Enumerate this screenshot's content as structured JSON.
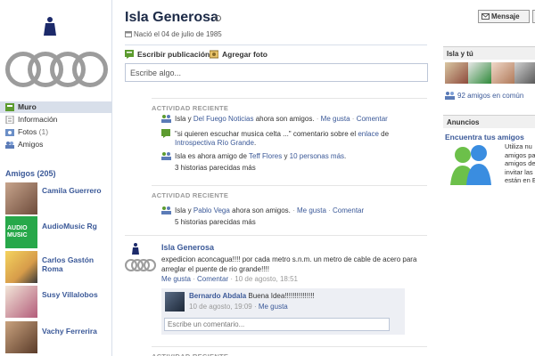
{
  "profile": {
    "name": "Isla Generosa",
    "birth": "Nació el 04 de julio de 1985"
  },
  "left_nav": {
    "items": [
      {
        "label": "Muro",
        "active": true
      },
      {
        "label": "Información"
      },
      {
        "label": "Fotos",
        "count": "(1)"
      },
      {
        "label": "Amigos"
      }
    ],
    "friends_header": "Amigos (205)",
    "friends": [
      {
        "name": "Camila Guerrero"
      },
      {
        "name": "AudioMusic Rg",
        "pic_text": "AUDIO\nMUSIC"
      },
      {
        "name": "Carlos Gastón Roma"
      },
      {
        "name": "Susy Villalobos"
      },
      {
        "name": "Vachy Ferrerira"
      }
    ]
  },
  "tabs": {
    "write_post": "Escribir publicación",
    "add_photo": "Agregar foto"
  },
  "composer": {
    "placeholder": "Escribe algo..."
  },
  "activity": [
    {
      "header": "ACTIVIDAD RECIENTE",
      "line1": {
        "pre": "Isla y ",
        "link": "Del Fuego Noticias",
        "post": " ahora son amigos.",
        "action1": "Me gusta",
        "action2": "Comentar"
      },
      "line2a": {
        "text1": "\"si quieren escuchar musica celta ...\"",
        "text2": " comentario sobre el ",
        "link": "enlace",
        "text3": " de"
      },
      "line2b": {
        "link": "Introspectiva Río Grande",
        "text": "."
      },
      "line3": {
        "pre": "Isla es ahora amigo de ",
        "link1": "Teff Flores",
        "mid": " y ",
        "link2": "10 personas más",
        "post": "."
      },
      "more": "3 historias parecidas más"
    },
    {
      "header": "ACTIVIDAD RECIENTE",
      "line1": {
        "pre": "Isla y ",
        "link": "Pablo Vega",
        "post": " ahora son amigos.",
        "action1": "Me gusta",
        "action2": "Comentar"
      },
      "more": "5 historias parecidas más"
    }
  ],
  "post": {
    "author": "Isla Generosa",
    "text": "expedicion aconcagua!!!! por cada metro s.n.m. un metro de cable de acero para arreglar el puente de rio grande!!!!",
    "meta_like": "Me gusta",
    "meta_comment": "Comentar",
    "meta_time": "10 de agosto, 18:51",
    "comment": {
      "author": "Bernardo Abdala",
      "text": "Buena Idea!!!!!!!!!!!!!!!",
      "time": "10 de agosto, 19:09",
      "like": "Me gusta"
    },
    "comment_placeholder": "Escribe un comentario..."
  },
  "activity3_header": "ACTIVIDAD RECIENTE",
  "right": {
    "message_button": "Mensaje",
    "isla_y_tu": "Isla y tú",
    "mutual_friends": "92 amigos en común",
    "ads_header": "Anuncios",
    "ad_title": "Encuentra tus amigos",
    "ad_text": [
      "Utiliza nu",
      "amigos pa",
      "amigos de",
      "invitar las",
      "están en E"
    ]
  },
  "colors": {
    "link": "#3b5998",
    "nav_active": "#d8dfea",
    "panel": "#edeff4"
  }
}
